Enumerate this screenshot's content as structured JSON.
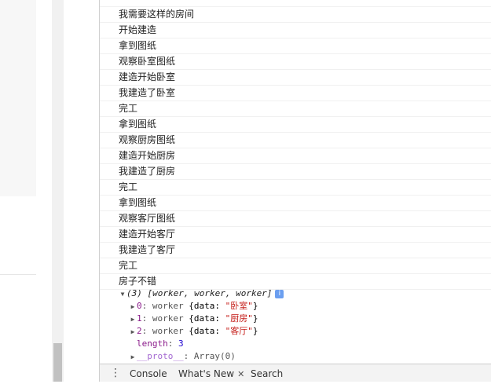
{
  "console": {
    "lines": [
      "我需要这样的房间",
      "开始建造",
      "拿到图纸",
      "观察卧室图纸",
      "建造开始卧室",
      "我建造了卧室",
      "完工",
      "拿到图纸",
      "观察厨房图纸",
      "建造开始厨房",
      "我建造了厨房",
      "完工",
      "拿到图纸",
      "观察客厅图纸",
      "建造开始客厅",
      "我建造了客厅",
      "完工",
      "房子不错"
    ],
    "array": {
      "summary": "(3) [worker, worker, worker]",
      "info_icon": "i",
      "items": [
        {
          "index": "0",
          "type": "worker",
          "prefix": "{data: ",
          "value": "\"卧室\"",
          "suffix": "}"
        },
        {
          "index": "1",
          "type": "worker",
          "prefix": "{data: ",
          "value": "\"厨房\"",
          "suffix": "}"
        },
        {
          "index": "2",
          "type": "worker",
          "prefix": "{data: ",
          "value": "\"客厅\"",
          "suffix": "}"
        }
      ],
      "length_key": "length",
      "length_value": "3",
      "proto_key": "__proto__",
      "proto_value": "Array(0)"
    }
  },
  "drawer": {
    "menu_icon": "⋮",
    "tabs": [
      {
        "label": "Console"
      },
      {
        "label": "What's New",
        "close": "✕"
      },
      {
        "label": "Search"
      }
    ]
  }
}
